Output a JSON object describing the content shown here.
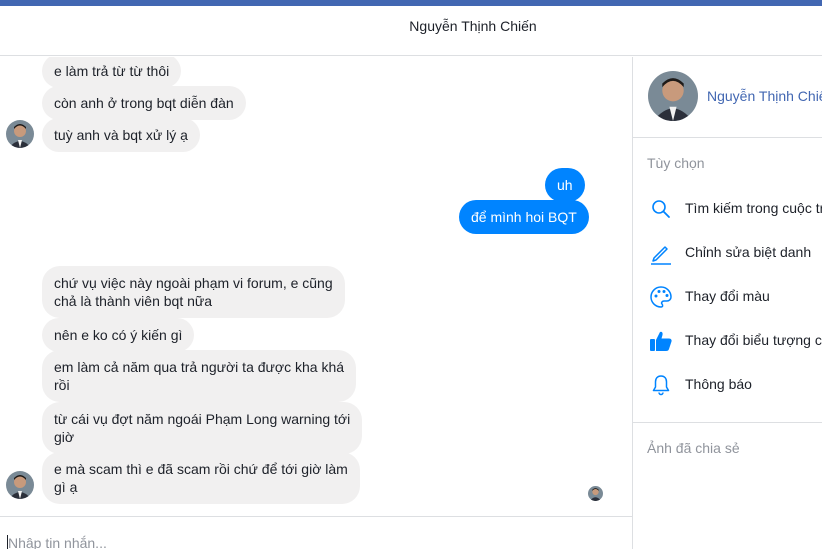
{
  "colors": {
    "accent": "#0084ff",
    "brand": "#4267b2",
    "incoming_bubble": "#f1f0f0"
  },
  "header": {
    "title": "Nguyễn Thịnh Chiến"
  },
  "messages_top": [
    {
      "text": "e làm trả từ từ thôi"
    },
    {
      "text": "còn anh ở trong bqt diễn đàn"
    },
    {
      "text": "tuỳ anh và bqt xử lý ạ"
    }
  ],
  "messages_out": [
    {
      "text": "uh"
    },
    {
      "text": "để mình hoi BQT"
    }
  ],
  "messages_bottom": [
    {
      "line1": "chứ vụ việc này ngoài phạm vi forum, e cũng",
      "line2": "chả là thành viên bqt nữa"
    },
    {
      "line1": "nên e ko có ý kiến gì",
      "line2": ""
    },
    {
      "line1": "em làm cả năm qua trả người ta được kha khá",
      "line2": "rồi"
    },
    {
      "line1": "từ cái vụ đợt năm ngoái Phạm Long warning tới",
      "line2": "giờ"
    },
    {
      "line1": "e mà scam thì e đã scam rồi chứ để tới giờ làm",
      "line2": "gì ạ"
    }
  ],
  "composer": {
    "placeholder": "Nhập tin nhắn..."
  },
  "sidebar": {
    "name": "Nguyễn Thịnh Chiến",
    "options_title": "Tùy chọn",
    "options": [
      {
        "label": "Tìm kiếm trong cuộc trò chuyện",
        "icon": "search-icon"
      },
      {
        "label": "Chỉnh sửa biệt danh",
        "icon": "pencil-icon"
      },
      {
        "label": "Thay đổi màu",
        "icon": "palette-icon"
      },
      {
        "label": "Thay đổi biểu tượng cảm xúc",
        "icon": "thumbs-up-icon"
      },
      {
        "label": "Thông báo",
        "icon": "bell-icon"
      }
    ],
    "shared_title": "Ảnh đã chia sẻ"
  }
}
